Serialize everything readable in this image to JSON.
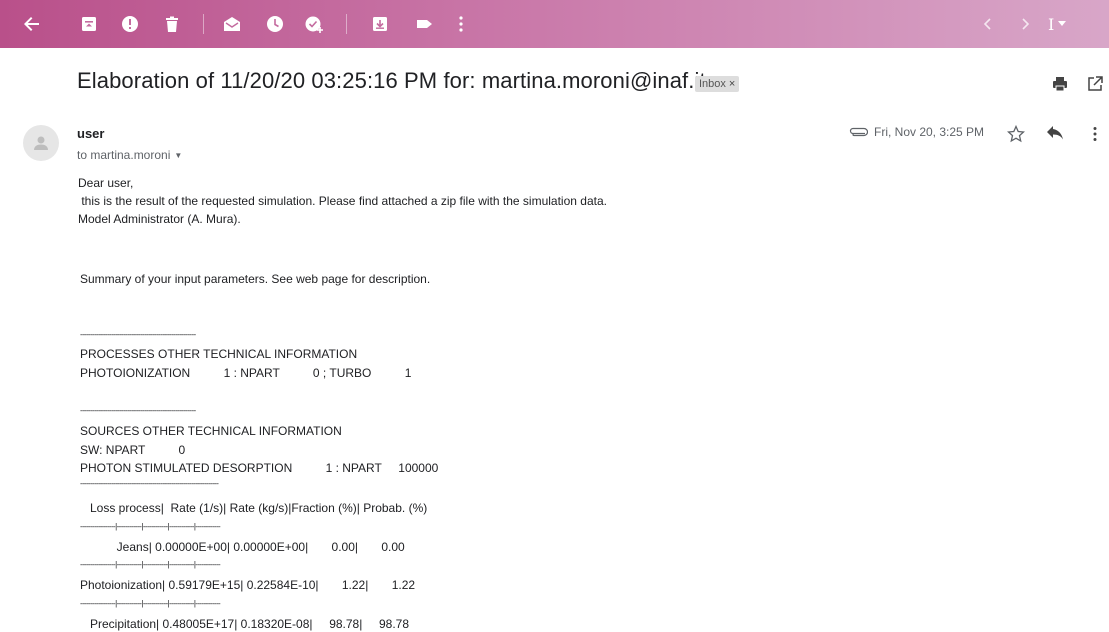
{
  "toolbar": {
    "icons": [
      "back-arrow-icon",
      "archive-icon",
      "report-spam-icon",
      "delete-icon",
      "mark-unread-icon",
      "snooze-icon",
      "add-to-tasks-icon",
      "move-to-icon",
      "label-icon",
      "more-vert-icon",
      "newer-icon",
      "older-icon",
      "input-tools-icon"
    ],
    "input_tools_glyph": "I",
    "colors": {
      "start": "#b9508a",
      "end": "#d8a6c8"
    }
  },
  "subject": "Elaboration of 11/20/20 03:25:16 PM for: martina.moroni@inaf.it",
  "label": {
    "text": "Inbox",
    "remove": "×"
  },
  "sender": {
    "name": "user",
    "to": "to martina.moroni",
    "date": "Fri, Nov 20, 3:25 PM"
  },
  "body": {
    "greeting": "Dear user,",
    "line1": " this is the result of the requested simulation. Please find attached a zip file with the simulation data.",
    "line2": "Model Administrator (A. Mura).",
    "summary": "Summary of your input parameters. See web page for description.",
    "sep1": "--------------------------------------------------------",
    "proc_title": "PROCESSES OTHER TECHNICAL INFORMATION",
    "proc_line": "PHOTOIONIZATION          1 : NPART          0 ; TURBO          1",
    "sep2": "--------------------------------------------------------",
    "src_title": "SOURCES OTHER TECHNICAL INFORMATION",
    "src_sw": "SW: NPART          0",
    "src_psd": "PHOTON STIMULATED DESORPTION          1 : NPART     100000",
    "sep3": "-------------------------------------------------------------------",
    "table_header": "   Loss process|  Rate (1/s)| Rate (kg/s)|Fraction (%)| Probab. (%)",
    "row_sep": "-----------------|------------|------------|------------|------------",
    "rows": [
      "           Jeans| 0.00000E+00| 0.00000E+00|       0.00|       0.00",
      "Photoionization| 0.59179E+15| 0.22584E-10|       1.22|       1.22",
      "   Precipitation| 0.48005E+17| 0.18320E-08|     98.78|     98.78"
    ]
  }
}
